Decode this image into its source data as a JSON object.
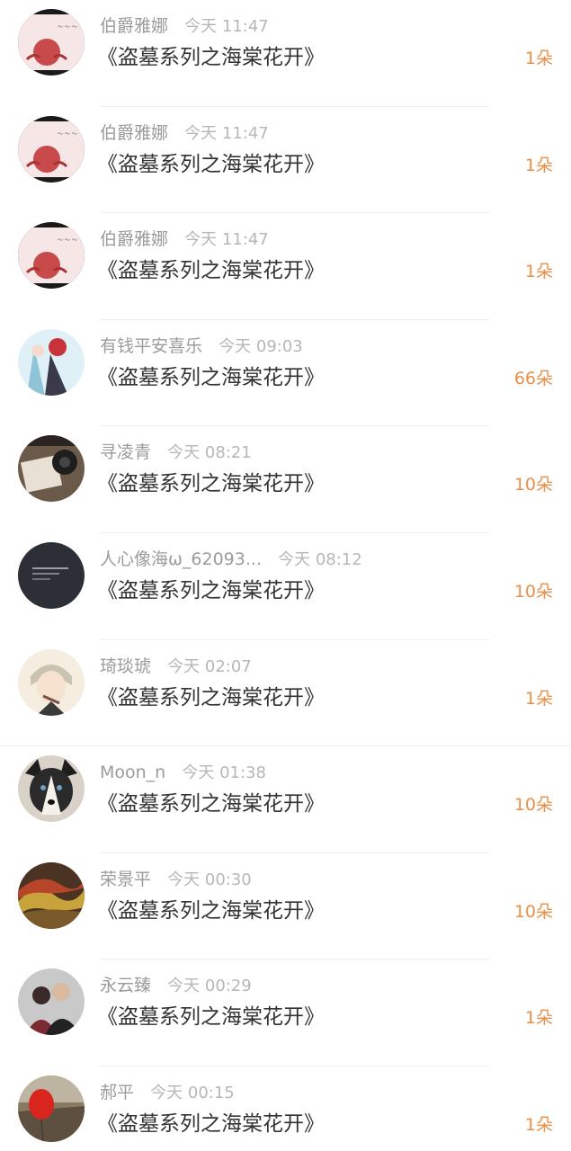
{
  "accent_color": "#e8904a",
  "rewards": [
    {
      "user": "伯爵雅娜",
      "time": "今天 11:47",
      "book": "《盗墓系列之海棠花开》",
      "amount": "1朵",
      "avatar": "crab-cartoon-avatar"
    },
    {
      "user": "伯爵雅娜",
      "time": "今天 11:47",
      "book": "《盗墓系列之海棠花开》",
      "amount": "1朵",
      "avatar": "crab-cartoon-avatar"
    },
    {
      "user": "伯爵雅娜",
      "time": "今天 11:47",
      "book": "《盗墓系列之海棠花开》",
      "amount": "1朵",
      "avatar": "crab-cartoon-avatar"
    },
    {
      "user": "有钱平安喜乐",
      "time": "今天 09:03",
      "book": "《盗墓系列之海棠花开》",
      "amount": "66朵",
      "avatar": "anime-couple-avatar"
    },
    {
      "user": "寻凌青",
      "time": "今天 08:21",
      "book": "《盗墓系列之海棠花开》",
      "amount": "10朵",
      "avatar": "camera-photo-avatar"
    },
    {
      "user": "人心像海ω_62093...",
      "time": "今天 08:12",
      "book": "《盗墓系列之海棠花开》",
      "amount": "10朵",
      "avatar": "dark-text-avatar"
    },
    {
      "user": "琦琰琥",
      "time": "今天 02:07",
      "book": "《盗墓系列之海棠花开》",
      "amount": "1朵",
      "avatar": "anime-boy-avatar"
    },
    {
      "user": "Moon_n",
      "time": "今天 01:38",
      "book": "《盗墓系列之海棠花开》",
      "amount": "10朵",
      "avatar": "husky-dog-avatar"
    },
    {
      "user": "荣景平",
      "time": "今天 00:30",
      "book": "《盗墓系列之海棠花开》",
      "amount": "10朵",
      "avatar": "autumn-leaves-avatar"
    },
    {
      "user": "永云臻",
      "time": "今天 00:29",
      "book": "《盗墓系列之海棠花开》",
      "amount": "1朵",
      "avatar": "couple-photo-avatar"
    },
    {
      "user": "郝平",
      "time": "今天 00:15",
      "book": "《盗墓系列之海棠花开》",
      "amount": "1朵",
      "avatar": "red-balloon-avatar"
    }
  ]
}
